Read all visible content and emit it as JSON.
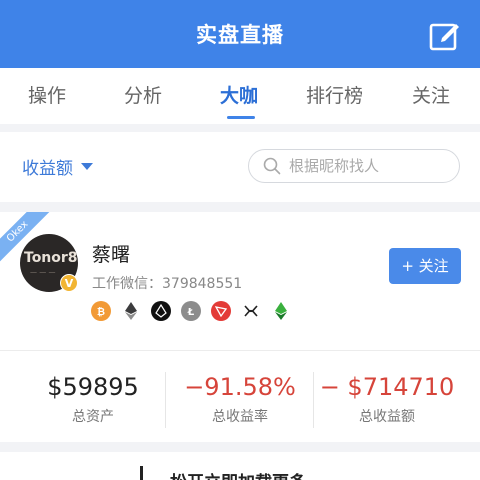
{
  "header": {
    "title": "实盘直播"
  },
  "tabs": [
    {
      "label": "操作"
    },
    {
      "label": "分析"
    },
    {
      "label": "大咖"
    },
    {
      "label": "排行榜"
    },
    {
      "label": "关注"
    }
  ],
  "filter": {
    "label": "收益额"
  },
  "search": {
    "placeholder": "根据昵称找人"
  },
  "trader": {
    "ribbon": "Okex",
    "avatar_text": "Tonor8",
    "verified": "V",
    "name": "蔡曙",
    "wechat": "工作微信：379848551",
    "follow_label": "+ 关注",
    "coins": [
      "btc-icon",
      "eth-icon",
      "eos-icon",
      "ltc-icon",
      "trx-icon",
      "xrp-icon",
      "etc-icon"
    ]
  },
  "stats": [
    {
      "value": "$59895",
      "label": "总资产",
      "color": "#222222"
    },
    {
      "value": "−91.58%",
      "label": "总收益率",
      "color": "#d6443a"
    },
    {
      "value": "− $714710",
      "label": "总收益额",
      "color": "#d6443a"
    }
  ],
  "loading": {
    "text": "松开立即加载更多"
  }
}
